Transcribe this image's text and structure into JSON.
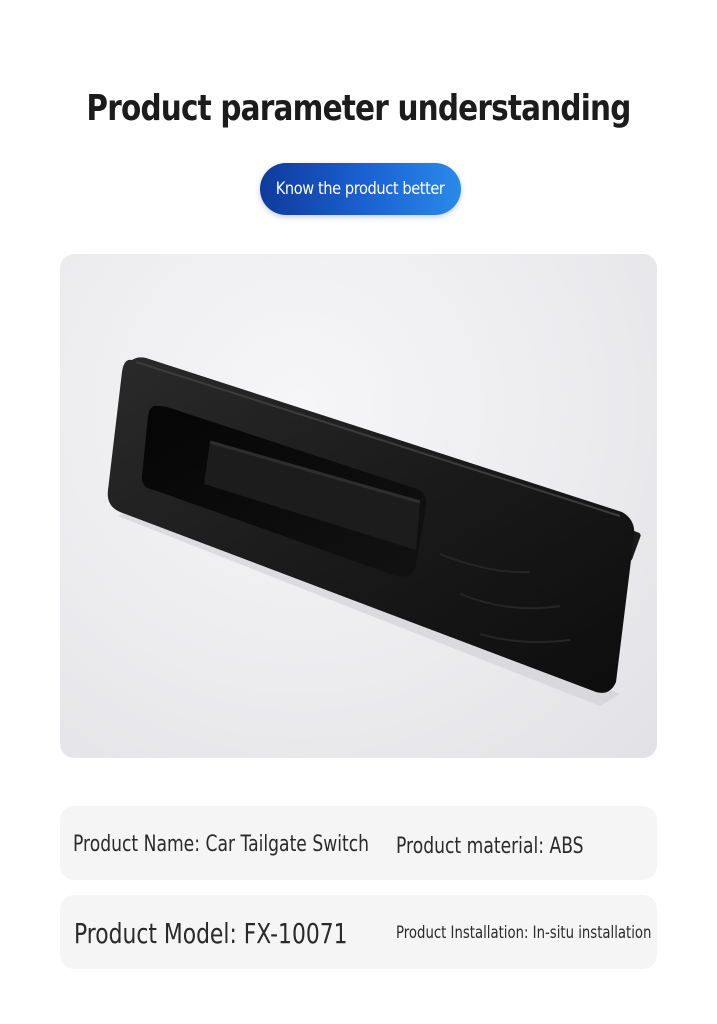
{
  "header": {
    "title": "Product parameter understanding",
    "subtitle_button": "Know the product better"
  },
  "product_image": {
    "description_icon": "car-tailgate-switch-photo"
  },
  "params": {
    "name": "Product Name: Car Tailgate Switch",
    "material": "Product material: ABS",
    "model": "Product Model: FX-10071",
    "installation": "Product Installation: In-situ installation"
  },
  "colors": {
    "accent_start": "#0f3a9c",
    "accent_end": "#2a8ae8",
    "card_bg": "#f5f5f6"
  }
}
